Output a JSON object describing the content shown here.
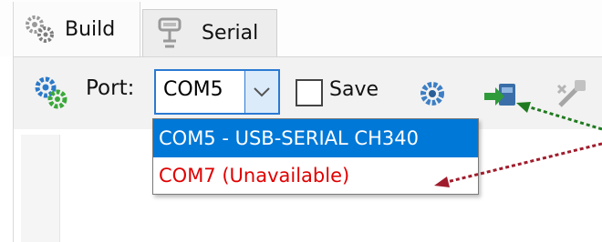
{
  "tabs": [
    {
      "label": "Build",
      "icon": "gears-icon",
      "active": true
    },
    {
      "label": "Serial",
      "icon": "serial-port-icon",
      "active": false
    }
  ],
  "toolbar": {
    "port_label": "Port:",
    "port_value": "COM5",
    "save_label": "Save",
    "save_checked": false
  },
  "port_dropdown": {
    "options": [
      {
        "label": "COM5 - USB-SERIAL CH340",
        "selected": true
      },
      {
        "label": "COM7 (Unavailable)",
        "selected": false,
        "color": "#e00000"
      }
    ]
  },
  "colors": {
    "selection": "#0078d7",
    "unavailable": "#e00000",
    "arrow_green": "#1f7a1f",
    "arrow_red": "#a01c2c"
  }
}
